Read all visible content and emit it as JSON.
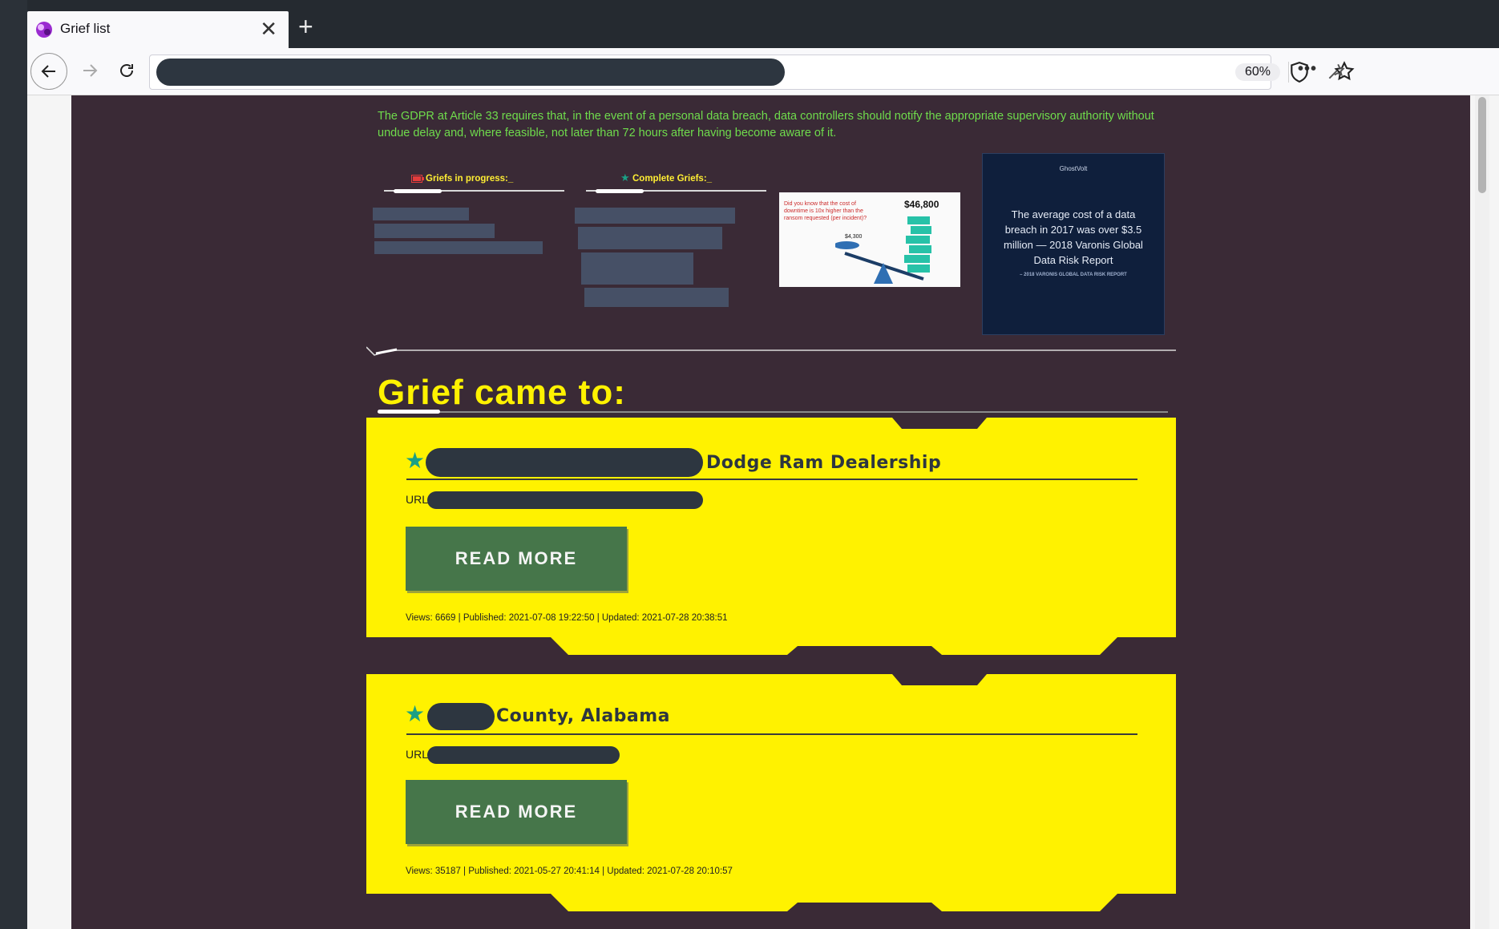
{
  "browser": {
    "tab_title": "Grief list",
    "tab_close": "✕",
    "new_tab": "+",
    "zoom": "60%",
    "more": "•••"
  },
  "page": {
    "gdpr_notice": "The GDPR at Article 33 requires that, in the event of a personal data breach, data controllers should notify the appropriate supervisory authority without undue delay and, where feasible, not later than 72 hours after having become aware of it.",
    "panels": [
      {
        "label": "Griefs in progress:_",
        "icon": "battery-icon"
      },
      {
        "label": "Complete Griefs:_",
        "icon": "star-icon"
      }
    ],
    "ad": {
      "question": "Did you know that the cost of downtime is 10x higher than the ransom requested (per incident)?",
      "price_high": "$46,800",
      "price_low": "$4,300"
    },
    "report": {
      "brand": "GhostVolt",
      "text": "The average cost of a data breach in 2017 was over $3.5 million — 2018 Varonis Global Data Risk Report",
      "cite": "– 2018 VARONIS GLOBAL DATA RISK REPORT"
    },
    "section_title": "Grief came to:",
    "colors": {
      "accent": "#fff200",
      "bg": "#3a2a36",
      "button": "#46764a",
      "star": "#1aa085",
      "gdpr": "#6fdc4c"
    }
  },
  "cards": [
    {
      "title": "Dodge Ram Dealership",
      "url_label": "URL",
      "read_more": "READ MORE",
      "meta": "Views: 6669 | Published: 2021-07-08 19:22:50 | Updated: 2021-07-28 20:38:51"
    },
    {
      "title": "County, Alabama",
      "url_label": "URL",
      "read_more": "READ MORE",
      "meta": "Views: 35187 | Published: 2021-05-27 20:41:14 | Updated: 2021-07-28 20:10:57"
    }
  ]
}
